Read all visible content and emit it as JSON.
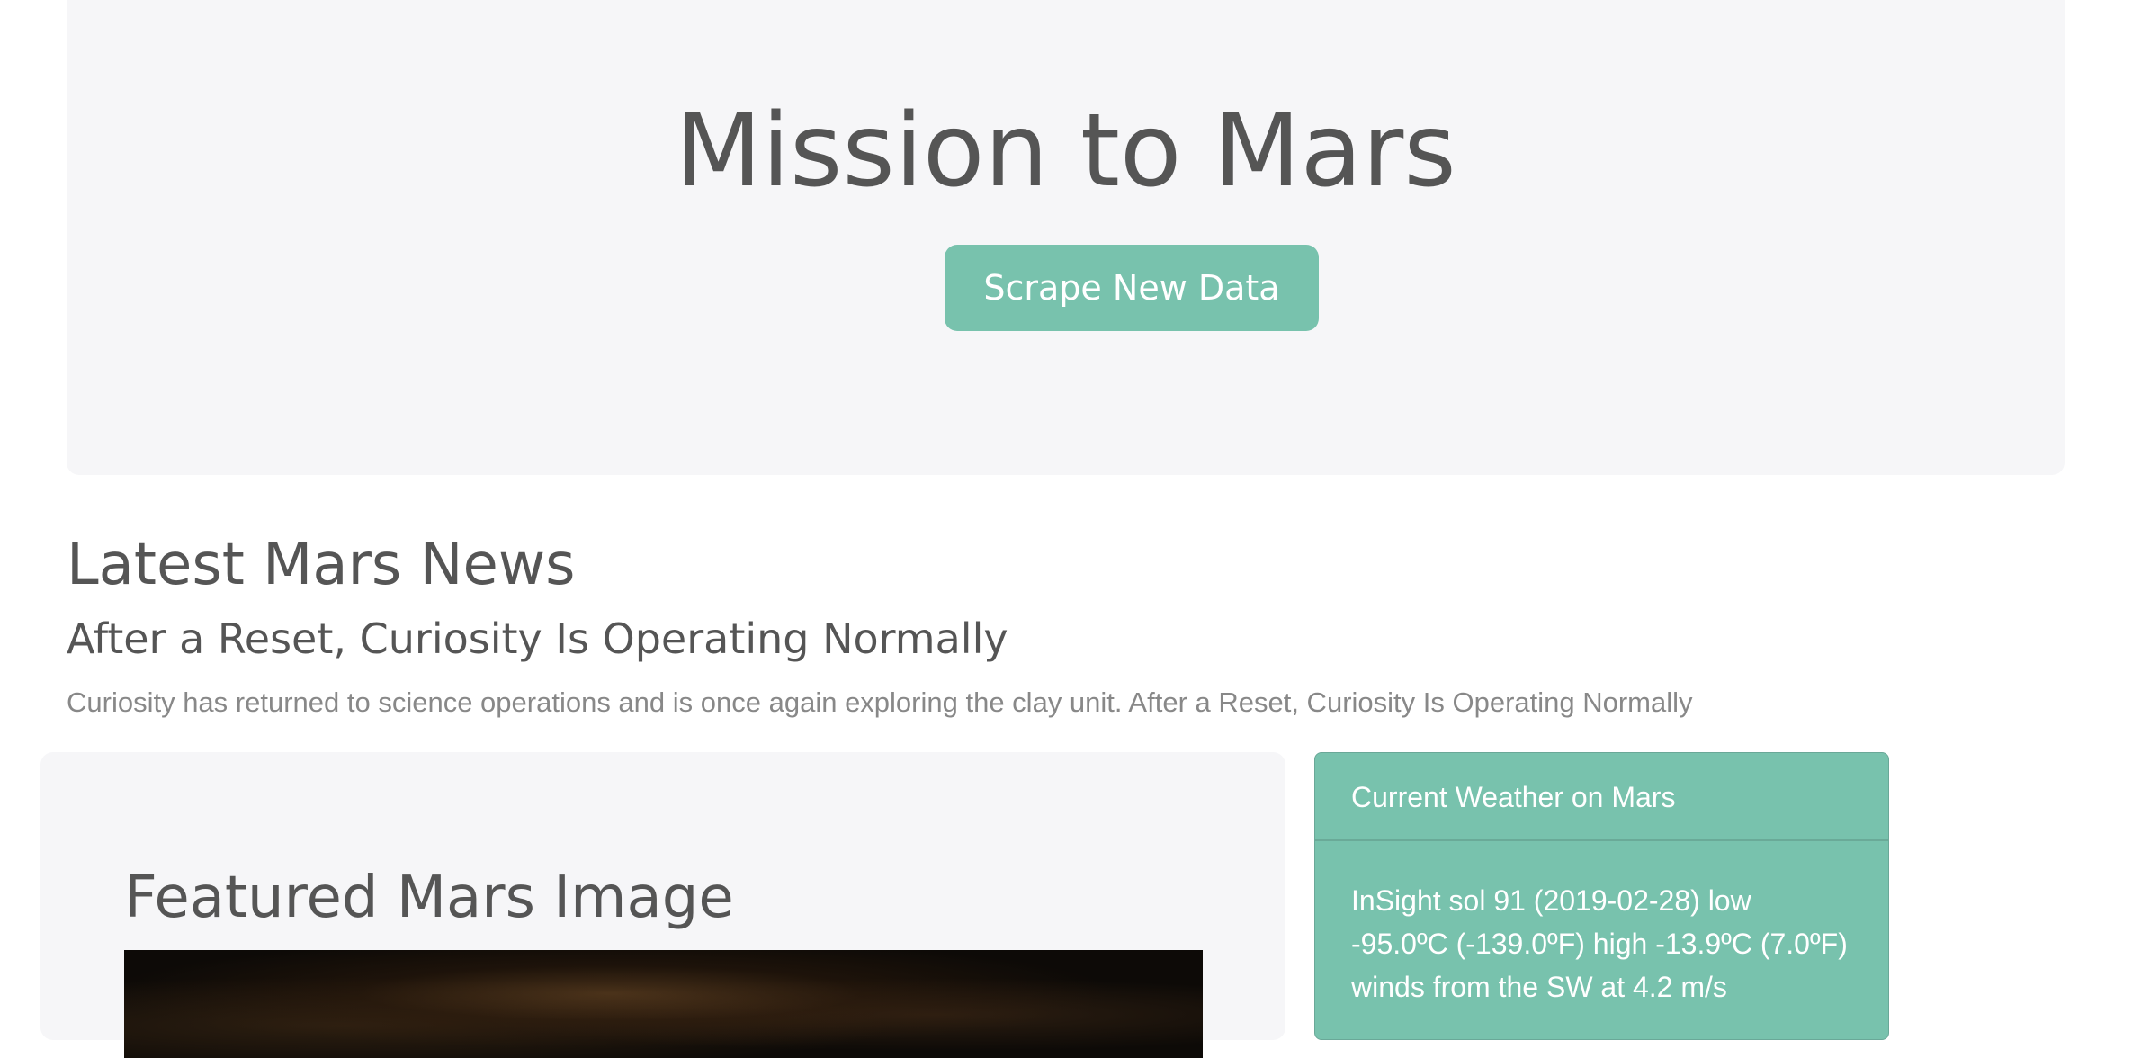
{
  "header": {
    "title": "Mission to Mars",
    "scrape_button_label": "Scrape New Data"
  },
  "news": {
    "section_heading": "Latest Mars News",
    "title": "After a Reset, Curiosity Is Operating Normally",
    "teaser": "Curiosity has returned to science operations and is once again exploring the clay unit. After a Reset, Curiosity Is Operating Normally"
  },
  "featured": {
    "heading": "Featured Mars Image"
  },
  "weather": {
    "header": "Current Weather on Mars",
    "text": "InSight sol 91 (2019-02-28) low -95.0ºC (-139.0ºF) high -13.9ºC (7.0ºF) winds from the SW at 4.2 m/s"
  },
  "colors": {
    "accent": "#78c2ad",
    "panel_bg": "#f6f6f8",
    "text": "#555555",
    "muted_text": "#888888"
  }
}
